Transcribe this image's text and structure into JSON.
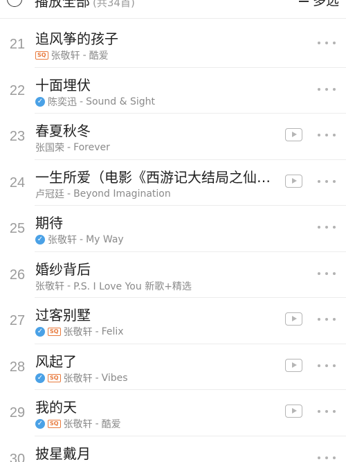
{
  "header": {
    "play_all_label": "播放全部",
    "play_all_count": "(共34首)",
    "multiselect_label": "多选"
  },
  "songs": [
    {
      "index": "21",
      "title": "追风筝的孩子",
      "artist": "张敬轩",
      "separator": " - ",
      "album": "酷爱",
      "verified": false,
      "sq": true,
      "mv": false,
      "sq_text": "SQ"
    },
    {
      "index": "22",
      "title": "十面埋伏",
      "artist": "陈奕迅",
      "separator": " - ",
      "album": "Sound & Sight",
      "verified": true,
      "sq": false,
      "mv": false,
      "sq_text": "SQ"
    },
    {
      "index": "23",
      "title": "春夏秋冬",
      "artist": "张国荣",
      "separator": " - ",
      "album": "Forever",
      "verified": false,
      "sq": false,
      "mv": true,
      "sq_text": "SQ"
    },
    {
      "index": "24",
      "title": "一生所爱（电影《西游记大结局之仙履奇缘》插曲）",
      "artist": "卢冠廷",
      "separator": " - ",
      "album": "Beyond Imagination",
      "verified": false,
      "sq": false,
      "mv": true,
      "sq_text": "SQ"
    },
    {
      "index": "25",
      "title": "期待",
      "artist": "张敬轩",
      "separator": " - ",
      "album": "My Way",
      "verified": true,
      "sq": false,
      "mv": false,
      "sq_text": "SQ"
    },
    {
      "index": "26",
      "title": "婚纱背后",
      "artist": "张敬轩",
      "separator": " - ",
      "album": "P.S. I Love You 新歌+精选",
      "verified": false,
      "sq": false,
      "mv": false,
      "sq_text": "SQ"
    },
    {
      "index": "27",
      "title": "过客别墅",
      "artist": "张敬轩",
      "separator": " - ",
      "album": "Felix",
      "verified": true,
      "sq": true,
      "mv": true,
      "sq_text": "SQ"
    },
    {
      "index": "28",
      "title": "风起了",
      "artist": "张敬轩",
      "separator": " - ",
      "album": "Vibes",
      "verified": true,
      "sq": true,
      "mv": true,
      "sq_text": "SQ"
    },
    {
      "index": "29",
      "title": "我的天",
      "artist": "张敬轩",
      "separator": " - ",
      "album": "酷爱",
      "verified": true,
      "sq": true,
      "mv": true,
      "sq_text": "SQ"
    },
    {
      "index": "30",
      "title": "披星戴月",
      "artist": "",
      "separator": "",
      "album": "",
      "verified": false,
      "sq": false,
      "mv": false,
      "sq_text": "SQ"
    }
  ],
  "icons": {
    "verified": "verified-check-icon",
    "sq": "sq-quality-badge",
    "mv": "mv-play-icon",
    "more": "more-dots-icon",
    "play_all": "play-circle-icon",
    "multiselect": "list-check-icon"
  },
  "colors": {
    "verified": "#4aa1e6",
    "sq_badge": "#e8793b",
    "title": "#1f1f1f",
    "subtitle": "#8a8a8a",
    "index": "#9b9b9b",
    "icon_gray": "#b3b3b3"
  }
}
